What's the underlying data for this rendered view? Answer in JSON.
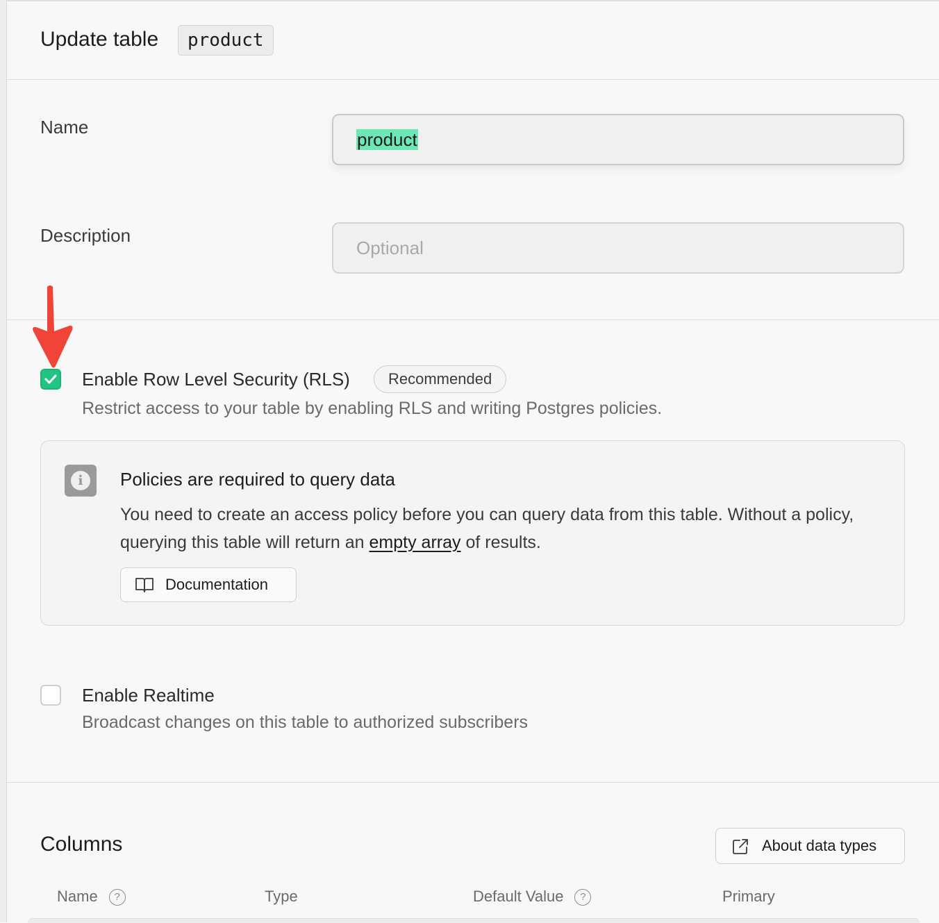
{
  "header": {
    "title": "Update table",
    "table_name_chip": "product"
  },
  "form": {
    "name_label": "Name",
    "name_value": "product",
    "description_label": "Description",
    "description_placeholder": "Optional"
  },
  "rls": {
    "checked": true,
    "title": "Enable Row Level Security (RLS)",
    "badge": "Recommended",
    "description": "Restrict access to your table by enabling RLS and writing Postgres policies.",
    "alert": {
      "icon": "info-icon",
      "title": "Policies are required to query data",
      "body_before": "You need to create an access policy before you can query data from this table. Without a policy, querying this table will return an ",
      "body_link": "empty array",
      "body_after": " of results.",
      "button_label": "Documentation",
      "button_icon": "book-icon"
    }
  },
  "realtime": {
    "checked": false,
    "title": "Enable Realtime",
    "description": "Broadcast changes on this table to authorized subscribers"
  },
  "columns": {
    "title": "Columns",
    "about_button": "About data types",
    "about_icon": "external-link-icon",
    "headers": {
      "name": "Name",
      "type": "Type",
      "default_value": "Default Value",
      "primary": "Primary"
    },
    "help_glyph": "?"
  },
  "colors": {
    "accent": "#23c483",
    "selection": "#6ee7b7",
    "annotation_arrow": "#f04438"
  }
}
